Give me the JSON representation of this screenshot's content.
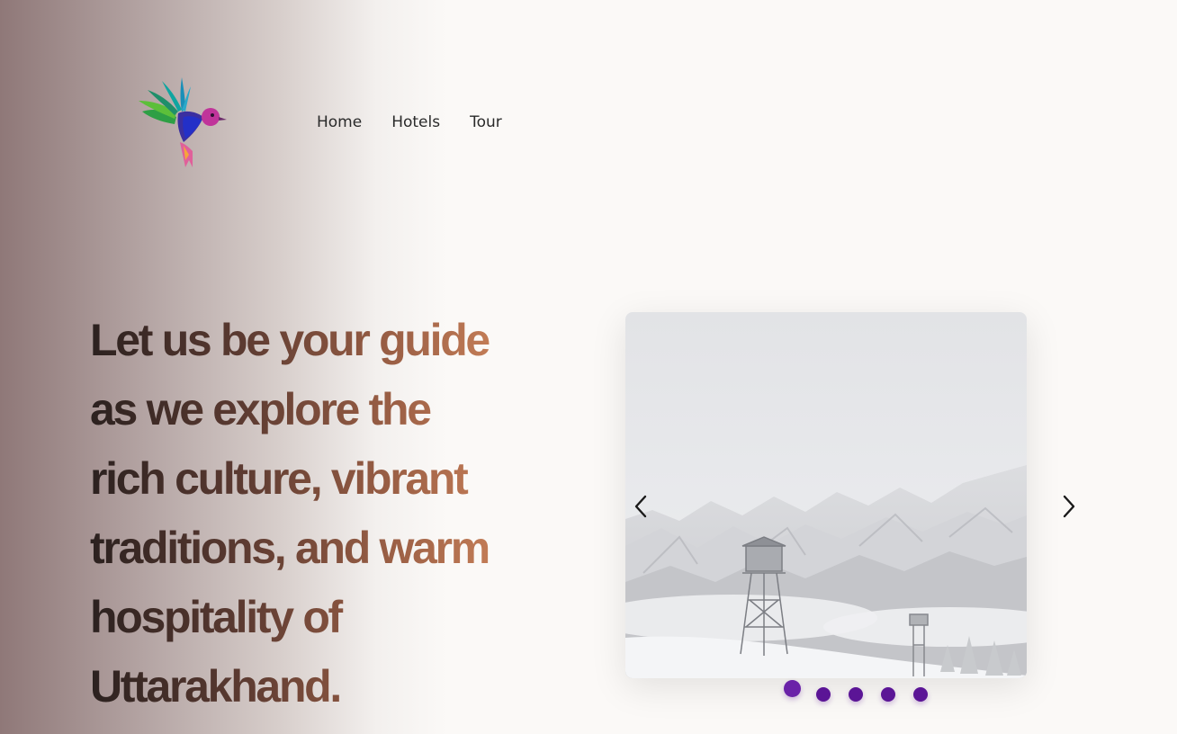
{
  "logo": {
    "icon": "hummingbird-logo-icon"
  },
  "nav": {
    "items": [
      {
        "label": "Home"
      },
      {
        "label": "Hotels"
      },
      {
        "label": "Tour"
      }
    ]
  },
  "hero": {
    "lines": [
      "Let us be your guide",
      "as we explore the",
      "rich culture, vibrant",
      "traditions, and warm",
      "hospitality of",
      "Uttarakhand."
    ]
  },
  "carousel": {
    "prev_icon": "chevron-left-icon",
    "next_icon": "chevron-right-icon",
    "slide_image": "snowy-mountain-watchtower-photo",
    "slide_count": 5,
    "active_index": 0,
    "dot_color": "#5b1596"
  },
  "colors": {
    "text_dark": "#2b211f",
    "text_accent": "#d78b5f",
    "background": "#fbf9f7",
    "left_gradient": "#8f7878"
  }
}
